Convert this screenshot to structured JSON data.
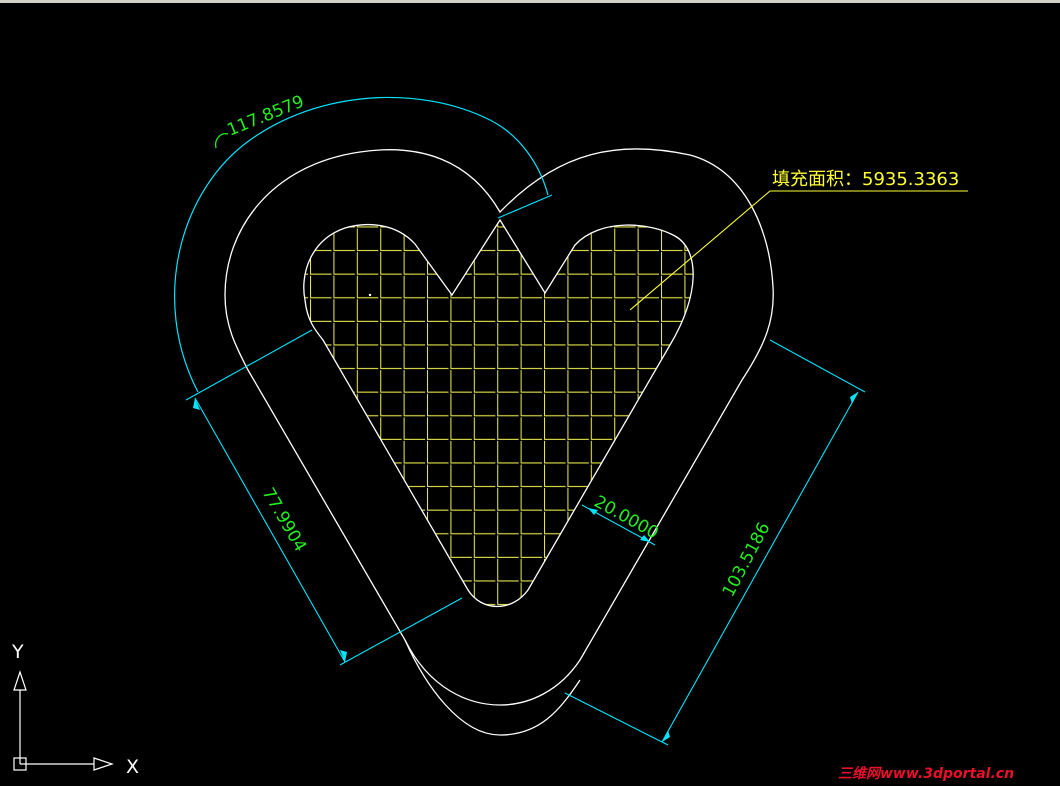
{
  "drawing": {
    "arc_length_label": "117.8579",
    "area_label": "填充面积：5935.3363",
    "offset_label": "20.0000",
    "left_length_label": "77.9904",
    "right_length_label": "103.5186"
  },
  "ucs": {
    "x_label": "X",
    "y_label": "Y"
  },
  "watermark": "三维网www.3dportal.cn",
  "colors": {
    "background": "#000000",
    "geometry": "#ffffff",
    "dimension": "#00e5ff",
    "dimension_text": "#22ee22",
    "hatch": "#e5e54a",
    "leader": "#ffff33",
    "watermark": "#e8102a"
  }
}
